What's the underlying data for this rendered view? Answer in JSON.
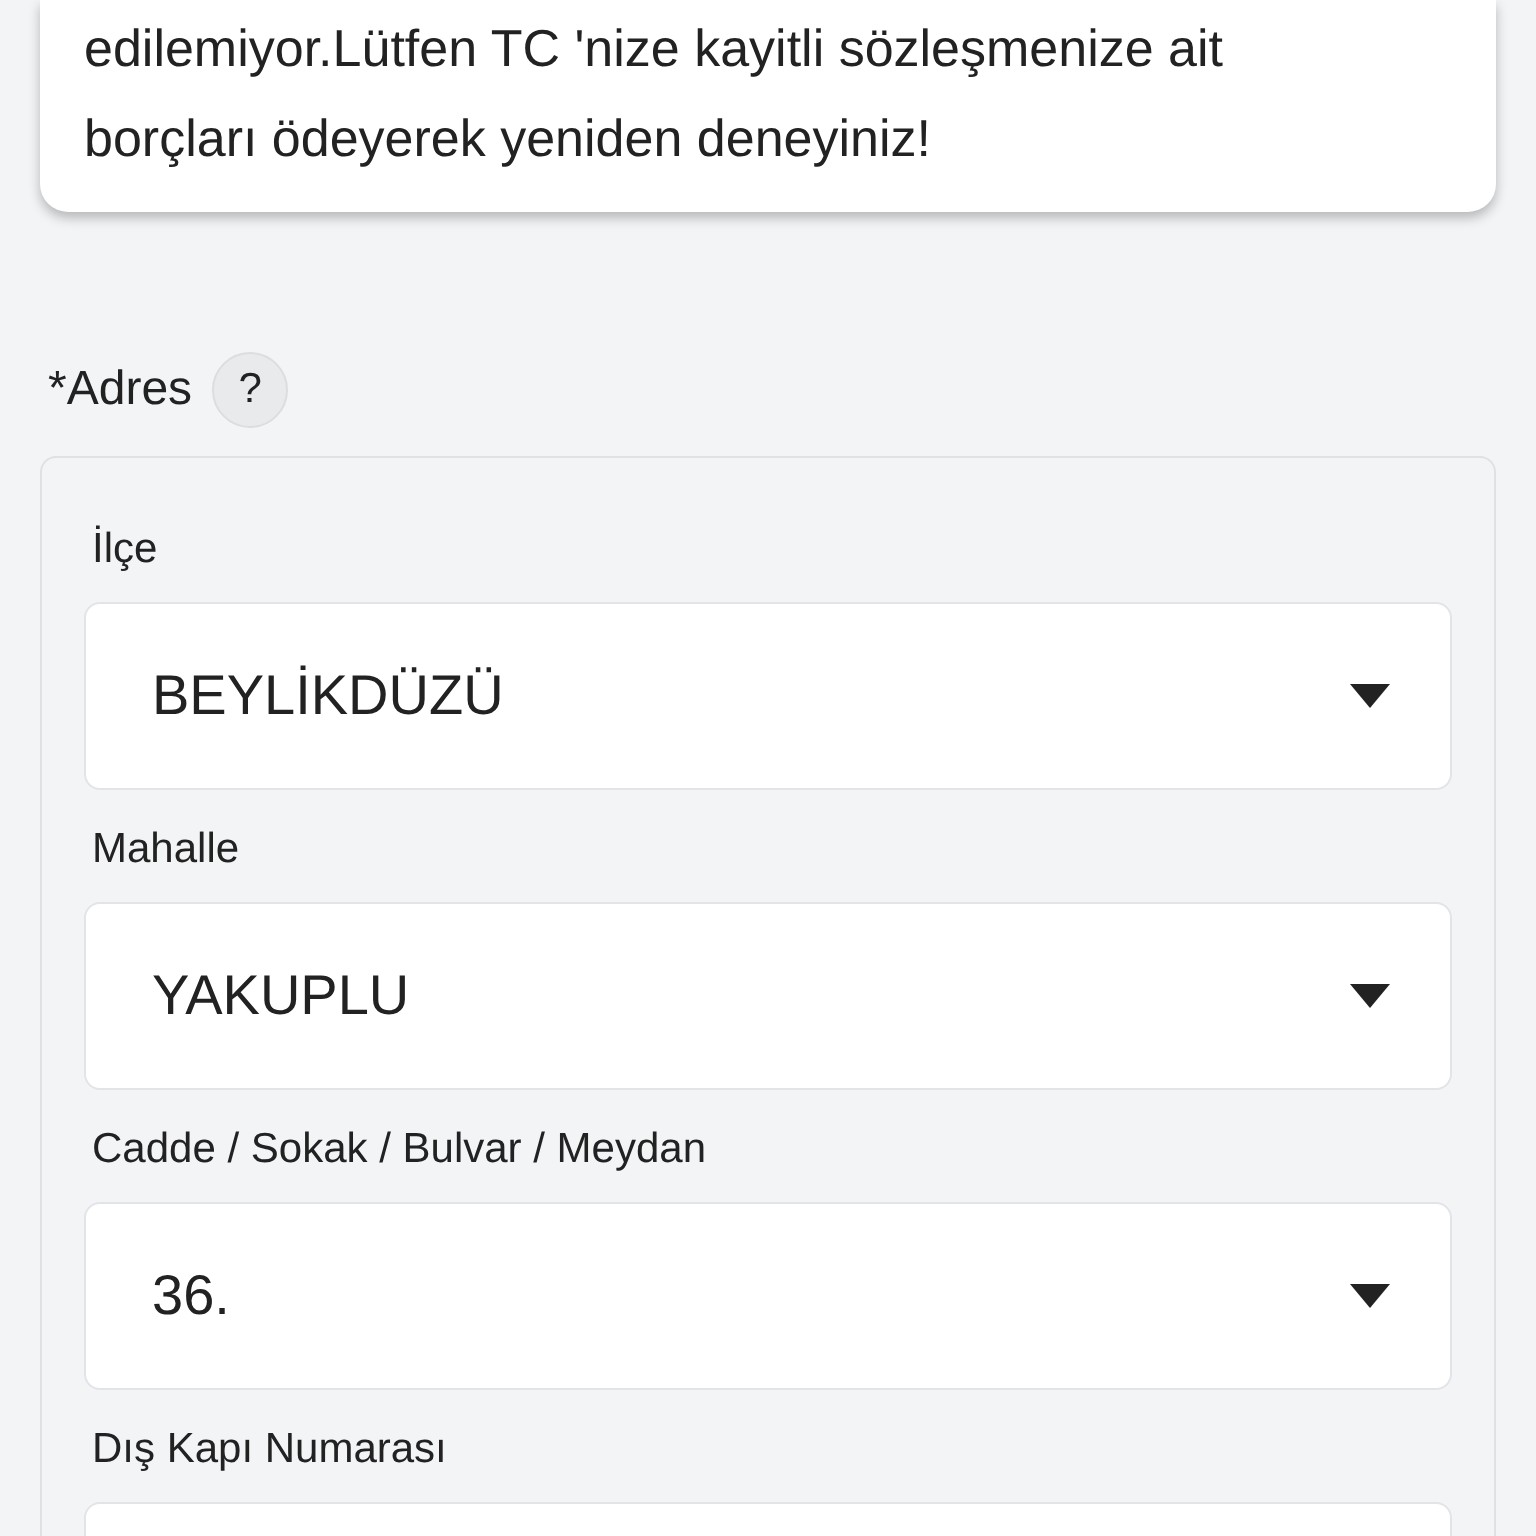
{
  "alert": {
    "lines": [
      "edilemiyor.Lütfen TC 'nize kayitli sözleşmenize ait",
      "borçları ödeyerek yeniden deneyiniz!"
    ]
  },
  "address": {
    "label": "*Adres",
    "help": "?",
    "fields": [
      {
        "kind": "select",
        "label": "İlçe",
        "value": "BEYLİKDÜZÜ"
      },
      {
        "kind": "select",
        "label": "Mahalle",
        "value": "YAKUPLU"
      },
      {
        "kind": "select",
        "label": "Cadde / Sokak / Bulvar / Meydan",
        "value": "36."
      },
      {
        "kind": "text",
        "label": "Dış Kapı Numarası"
      }
    ]
  }
}
